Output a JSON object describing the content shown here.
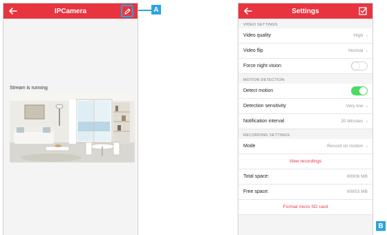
{
  "colors": {
    "accent": "#e8343f",
    "callout": "#2aa5e0",
    "toggle_on": "#4cd964"
  },
  "left_screen": {
    "title": "IPCamera",
    "back_icon": "arrow-left-icon",
    "edit_icon": "pencil-icon",
    "stream_status": "Stream is running"
  },
  "callouts": {
    "a": "A",
    "b": "B"
  },
  "right_screen": {
    "title": "Settings",
    "back_icon": "arrow-left-icon",
    "confirm_icon": "checkbox-check-icon",
    "video": {
      "header": "VIDEO SETTINGS",
      "quality_label": "Video quality",
      "quality_value": "High",
      "flip_label": "Video flip",
      "flip_value": "Normal",
      "night_label": "Force night vision",
      "night_on": false
    },
    "motion": {
      "header": "MOTION DETECTION",
      "detect_label": "Detect motion",
      "detect_on": true,
      "sensitivity_label": "Detection sensitivity",
      "sensitivity_value": "Very low",
      "interval_label": "Notification interval",
      "interval_value": "20 Minutes"
    },
    "recording": {
      "header": "RECORDING SETTINGS",
      "mode_label": "Mode",
      "mode_value": "Record on motion",
      "view_recordings": "View recordings",
      "total_label": "Total space:",
      "total_value": "60906 MB",
      "free_label": "Free space:",
      "free_value": "60853 MB",
      "format_label": "Format micro SD card"
    }
  }
}
